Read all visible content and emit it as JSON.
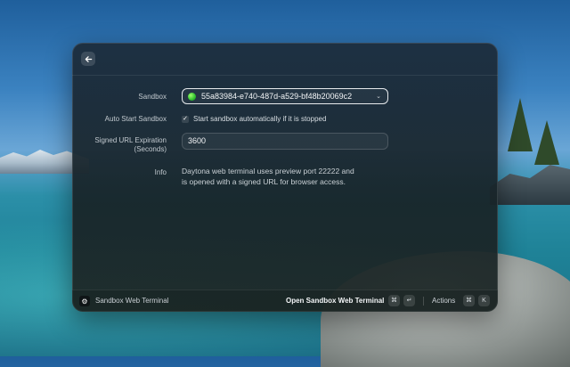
{
  "form": {
    "sandbox_label": "Sandbox",
    "sandbox_value": "55a83984-e740-487d-a529-bf48b20069c2",
    "sandbox_status_color": "#2fbf2f",
    "auto_start_label": "Auto Start Sandbox",
    "auto_start_checked": true,
    "auto_start_checkbox_text": "Start sandbox automatically if it is stopped",
    "expiration_label_line1": "Signed URL Expiration",
    "expiration_label_line2": "(Seconds)",
    "expiration_value": "3600",
    "info_label": "Info",
    "info_text": "Daytona web terminal uses preview port 22222 and is opened with a signed URL for browser access."
  },
  "footer": {
    "title": "Sandbox Web Terminal",
    "primary_action": "Open Sandbox Web Terminal",
    "primary_shortcut_mod": "⌘",
    "primary_shortcut_key": "↵",
    "actions_label": "Actions",
    "actions_shortcut_mod": "⌘",
    "actions_shortcut_key": "K"
  },
  "icons": {
    "back": "arrow-left-icon",
    "app": "gear-icon",
    "dropdown": "chevron-down-icon",
    "checkbox": "check-icon",
    "status": "status-dot-icon"
  }
}
